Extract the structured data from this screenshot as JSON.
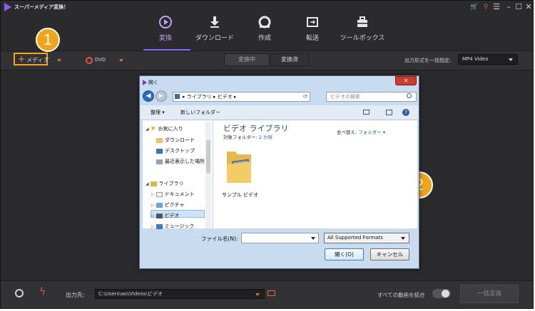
{
  "app": {
    "title": "スーパーメディア変換！"
  },
  "nav": {
    "tabs": [
      {
        "label": "変換",
        "active": true
      },
      {
        "label": "ダウンロード"
      },
      {
        "label": "作成"
      },
      {
        "label": "転送"
      },
      {
        "label": "ツールボックス"
      }
    ]
  },
  "toolbar": {
    "add_media": "メディア",
    "dvd": "DVD",
    "tab_converting": "変換中",
    "tab_converted": "変換済",
    "output_format_label": "出力形式を一括指定:",
    "output_format_value": "MP4 Video"
  },
  "badges": {
    "step1": "1",
    "step2": "2"
  },
  "dialog": {
    "title": "開く",
    "close": "✕",
    "address": "▸ ライブラリ ▸ ビデオ ▸",
    "search_placeholder": "ビデオの検索",
    "organize": "整理 ▾",
    "new_folder": "新しいフォルダー",
    "tree": {
      "favorites": "お気に入り",
      "downloads": "ダウンロード",
      "desktop": "デスクトップ",
      "recent": "最近表示した場所",
      "libraries": "ライブラリ",
      "documents": "ドキュメント",
      "pictures": "ピクチャ",
      "videos": "ビデオ",
      "music": "ミュージック"
    },
    "library_title": "ビデオ ライブラリ",
    "library_subtitle_prefix": "対象フォルダー: ",
    "library_subtitle_link": "2 か所",
    "sort_label": "並べ替え: ",
    "sort_value": "フォルダー ▾",
    "item_label": "サンプル ビデオ",
    "filename_label": "ファイル名(N):",
    "filename_value": "",
    "filter_value": "All Supported Formats",
    "open_button": "開く(O)",
    "cancel_button": "キャンセル"
  },
  "bottom": {
    "output_label": "出力先:",
    "output_path": "C:\\Users\\ws\\Videos\\ビデオ",
    "merge_label": "すべての動画を結合",
    "convert_all": "一括変換"
  },
  "colors": {
    "accent": "#8a68ff",
    "badge": "#f2a417",
    "highlight": "#f0a422"
  }
}
